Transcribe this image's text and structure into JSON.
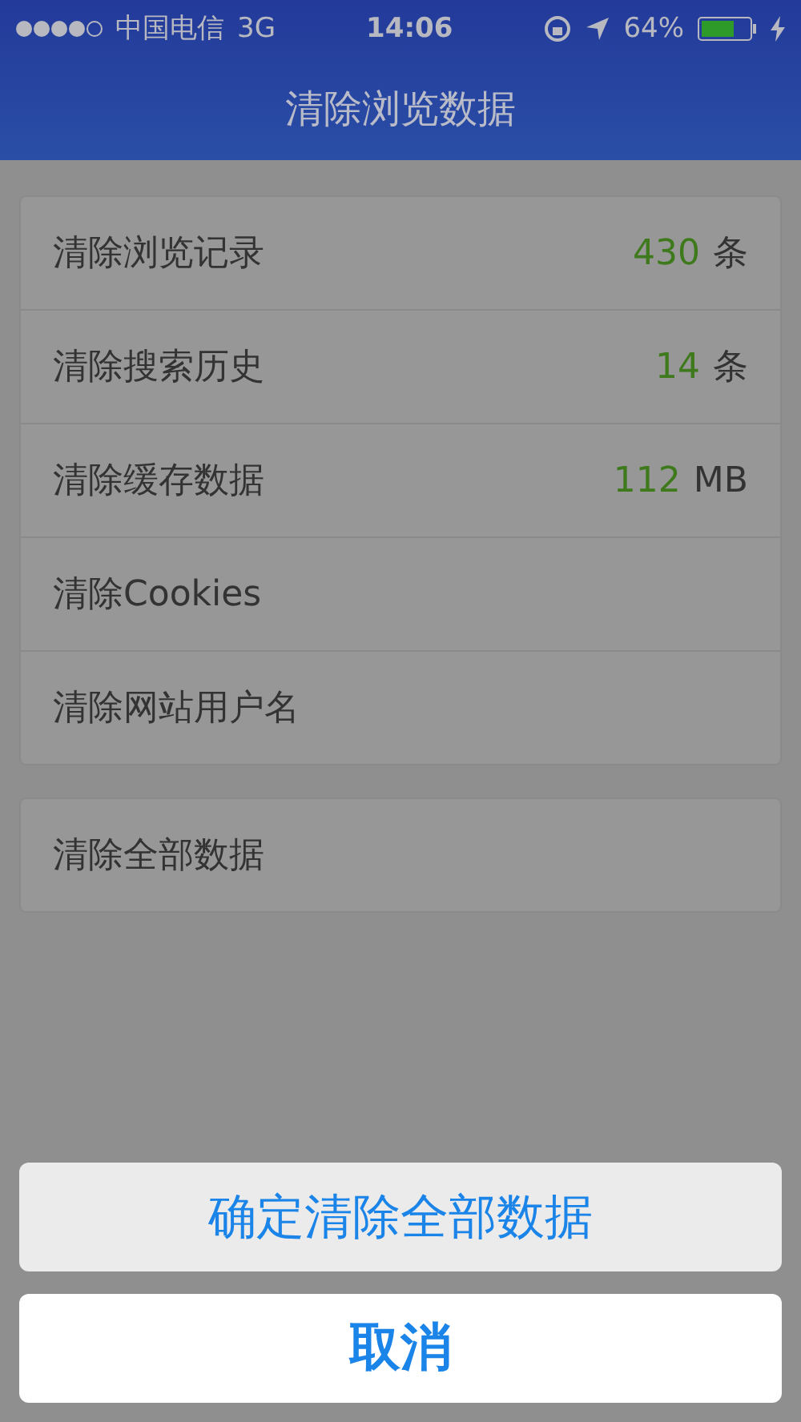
{
  "status_bar": {
    "carrier": "中国电信",
    "network": "3G",
    "time": "14:06",
    "battery": "64%"
  },
  "nav": {
    "title": "清除浏览数据"
  },
  "groups": [
    {
      "rows": [
        {
          "label": "清除浏览记录",
          "count": "430",
          "unit": "条"
        },
        {
          "label": "清除搜索历史",
          "count": "14",
          "unit": "条"
        },
        {
          "label": "清除缓存数据",
          "count": "112",
          "unit": "MB"
        },
        {
          "label": "清除Cookies"
        },
        {
          "label": "清除网站用户名"
        }
      ]
    },
    {
      "rows": [
        {
          "label": "清除全部数据"
        }
      ]
    }
  ],
  "action_sheet": {
    "buttons": [
      {
        "label": "确定清除全部数据",
        "kind": "action"
      },
      {
        "label": "取消",
        "kind": "cancel"
      }
    ]
  }
}
